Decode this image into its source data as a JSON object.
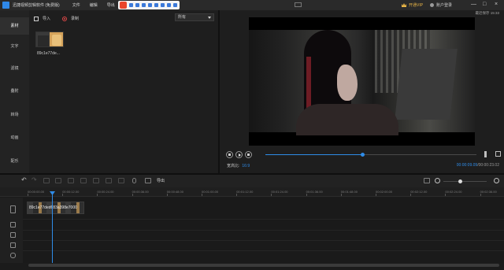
{
  "window": {
    "title": "迅捷视频剪辑软件 (免费版)",
    "menu": [
      "文件",
      "编辑",
      "导出"
    ],
    "vip_label": "开通VIP",
    "account_label": "账户登录",
    "controls": [
      "—",
      "□",
      "×"
    ]
  },
  "nav": {
    "items": [
      {
        "label": "素材",
        "active": true
      },
      {
        "label": "文字",
        "active": false
      },
      {
        "label": "滤镜",
        "active": false
      },
      {
        "label": "叠附",
        "active": false
      },
      {
        "label": "转场",
        "active": false
      },
      {
        "label": "动画",
        "active": false
      },
      {
        "label": "配乐",
        "active": false
      }
    ]
  },
  "media": {
    "import_label": "导入",
    "record_label": "录制",
    "filter_value": "所有",
    "clip_name": "89c1e77de..."
  },
  "preview": {
    "autosave": "最近保存 15:33",
    "ratio_label": "宽高比:",
    "ratio_value": "16:9",
    "current_time": "00:00:09.09",
    "total_time": "/00:00:23.02",
    "progress_fraction": 0.46
  },
  "timeline": {
    "export_label": "导出",
    "ruler": [
      "00:00:00.00",
      "00:00:12.00",
      "00:00:24.00",
      "00:00:36.00",
      "00:00:48.00",
      "00:01:00.00",
      "00:01:12.00",
      "00:01:24.00",
      "00:01:36.00",
      "00:01:48.00",
      "00:02:00.00",
      "00:02:12.00",
      "00:02:24.00",
      "00:02:36.00"
    ],
    "clip_label": "89c1e77ded683a398e7000",
    "zoom_fraction": 0.38
  },
  "colors": {
    "accent": "#2f8ce8",
    "vip": "#e6b347",
    "background": "#1b1b1b"
  }
}
